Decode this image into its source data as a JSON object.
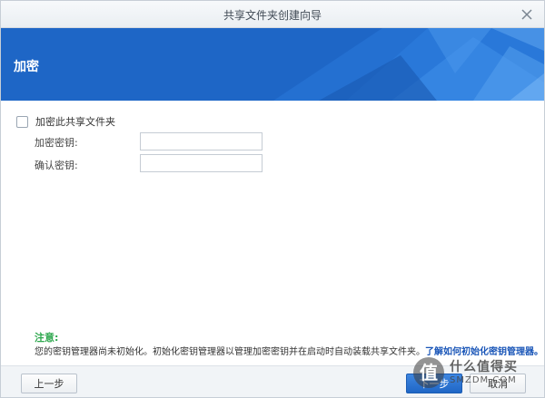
{
  "window": {
    "title": "共享文件夹创建向导"
  },
  "banner": {
    "title": "加密"
  },
  "form": {
    "encrypt_checkbox_label": "加密此共享文件夹",
    "encrypt_checked": false,
    "key_label": "加密密钥:",
    "key_value": "",
    "confirm_label": "确认密钥:",
    "confirm_value": ""
  },
  "note": {
    "title": "注意:",
    "text": "您的密钥管理器尚未初始化。初始化密钥管理器以管理加密密钥并在启动时自动装载共享文件夹。",
    "link": "了解如何初始化密钥管理器。"
  },
  "footer": {
    "prev_label": "上一步",
    "next_label": "下一步",
    "cancel_label": "取消"
  },
  "watermark": {
    "glyph": "值",
    "line1": "什么值得买",
    "line2": "SMZDM.COM"
  },
  "colors": {
    "banner": "#1e66c6",
    "accent": "#1a56b8",
    "note_title": "#2fa84f"
  },
  "icons": {
    "close": "close-icon",
    "checkbox": "checkbox-icon"
  }
}
